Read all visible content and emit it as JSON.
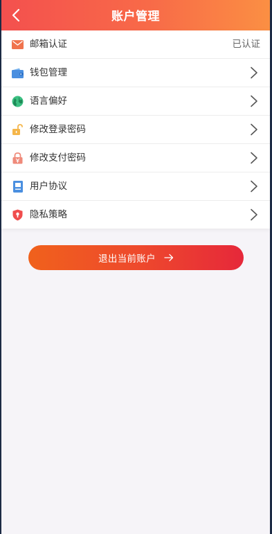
{
  "header": {
    "title": "账户管理",
    "back_icon": "back-chevron-icon"
  },
  "menu": {
    "items": [
      {
        "name": "email-verification",
        "label": "邮箱认证",
        "status": "已认证",
        "icon": "mail-icon",
        "icon_color": "#f0734d"
      },
      {
        "name": "wallet-management",
        "label": "钱包管理",
        "icon": "wallet-icon",
        "icon_color": "#4a8fe0"
      },
      {
        "name": "language-preference",
        "label": "语言偏好",
        "icon": "globe-icon",
        "icon_color": "#3cc082"
      },
      {
        "name": "change-login-password",
        "label": "修改登录密码",
        "icon": "unlock-icon",
        "icon_color": "#f5b64a"
      },
      {
        "name": "change-payment-password",
        "label": "修改支付密码",
        "icon": "payment-lock-icon",
        "icon_color": "#ef8a7a"
      },
      {
        "name": "user-agreement",
        "label": "用户协议",
        "icon": "document-icon",
        "icon_color": "#4a8fe0"
      },
      {
        "name": "privacy-policy",
        "label": "隐私策略",
        "icon": "shield-icon",
        "icon_color": "#f04d4d"
      }
    ]
  },
  "logout": {
    "label": "退出当前账户",
    "icon": "arrow-right-icon"
  },
  "colors": {
    "header_gradient_start": "#f4504e",
    "header_gradient_end": "#fb8f43",
    "button_gradient_start": "#f0611c",
    "button_gradient_end": "#e6283a",
    "page_background": "#f6f4f8"
  }
}
